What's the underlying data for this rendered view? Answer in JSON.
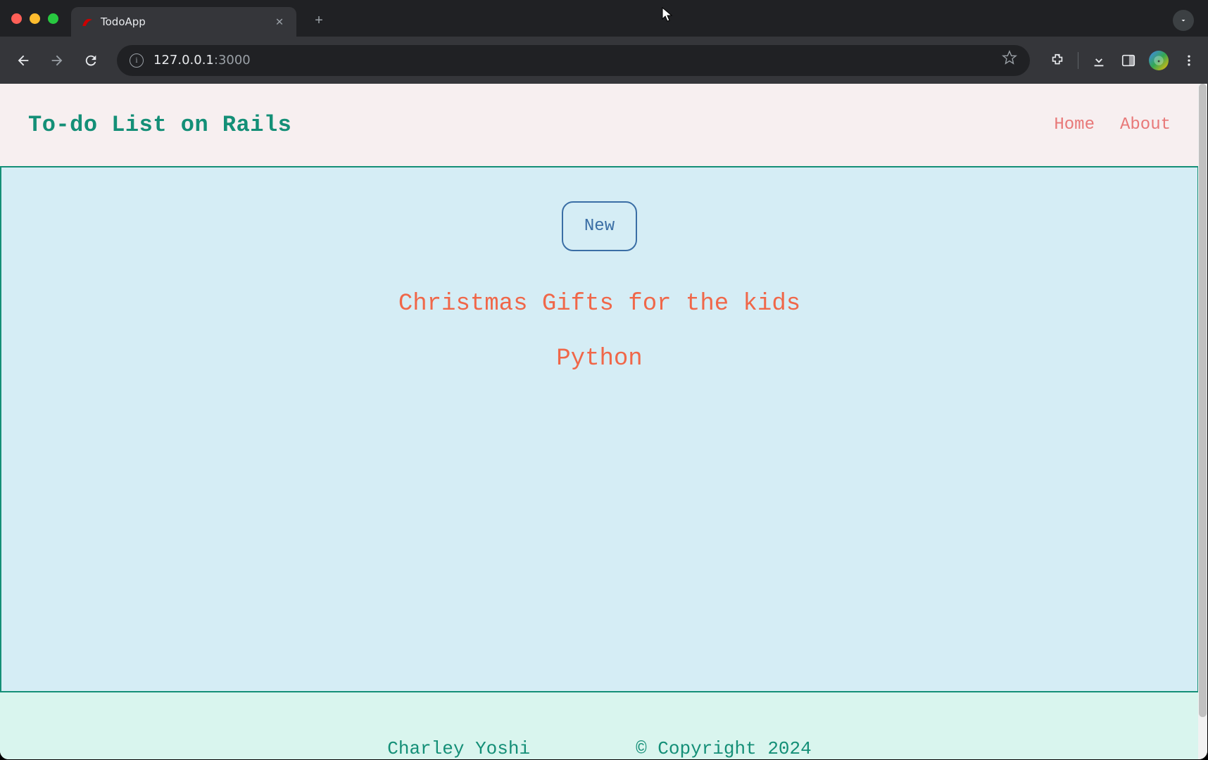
{
  "browser": {
    "tab_title": "TodoApp",
    "url_ip": "127.0.0.1",
    "url_port": ":3000"
  },
  "header": {
    "title": "To-do List on Rails",
    "nav": {
      "home": "Home",
      "about": "About"
    }
  },
  "main": {
    "new_button": "New",
    "todos": [
      "Christmas Gifts for the kids",
      "Python"
    ]
  },
  "footer": {
    "author": "Charley Yoshi",
    "copyright": "© Copyright 2024"
  }
}
